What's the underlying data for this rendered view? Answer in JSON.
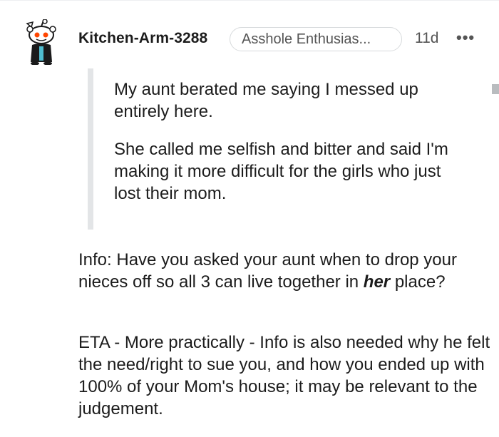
{
  "comment": {
    "author": "Kitchen-Arm-3288",
    "flair": "Asshole Enthusias...",
    "time": "11d",
    "more_glyph": "•••",
    "avatar_icon": "snoo-avatar-icon",
    "quote": [
      "My aunt berated me saying I messed up entirely here.",
      "She called me selfish and bitter and said I'm making it more difficult for the girls who just lost their mom."
    ],
    "body": {
      "p1_before": "Info: Have you asked your aunt when to drop your nieces off so all 3 can live together in ",
      "p1_emphasis": "her",
      "p1_after": " place?",
      "p2": "ETA - More practically - Info is also needed why he felt the need/right to sue you, and how you ended up with 100% of your Mom's house; it may be relevant to the judgement."
    }
  },
  "colors": {
    "text": "#1c1c1c",
    "meta": "#555555",
    "quote_bar": "#e3e5e7",
    "border": "#d7dadc"
  }
}
